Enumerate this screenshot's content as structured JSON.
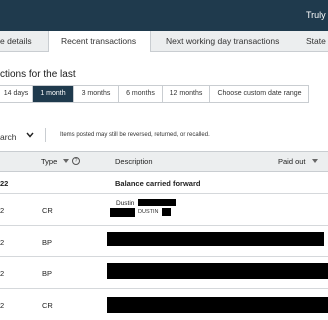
{
  "header": {
    "user_label": "Truly"
  },
  "tabs": [
    {
      "label": "e details"
    },
    {
      "label": "Recent transactions",
      "active": true
    },
    {
      "label": "Next working day transactions"
    },
    {
      "label": "State"
    }
  ],
  "heading": "ctions for the last",
  "ranges": [
    {
      "label": "14 days"
    },
    {
      "label": "1 month",
      "selected": true
    },
    {
      "label": "3 months"
    },
    {
      "label": "6 months"
    },
    {
      "label": "12 months"
    },
    {
      "label": "Choose custom date range"
    }
  ],
  "search": {
    "label": "arch",
    "note": "Items posted may still be reversed, returned, or recalled."
  },
  "table": {
    "headers": {
      "date": "",
      "type": "Type",
      "description": "Description",
      "paid_out": "Paid out"
    },
    "rows": [
      {
        "date": "22",
        "type": "",
        "description": "Balance carried forward",
        "bold": true
      },
      {
        "date": "2",
        "type": "CR",
        "description": "Dustin",
        "sub": "DUSTIN"
      },
      {
        "date": "2",
        "type": "BP",
        "description": ""
      },
      {
        "date": "2",
        "type": "BP",
        "description": ""
      },
      {
        "date": "2",
        "type": "CR",
        "description": ""
      }
    ]
  },
  "colors": {
    "header_bg": "#1f3a4d",
    "tab_bg": "#eceeef",
    "selected_range": "#1f3a4d"
  }
}
